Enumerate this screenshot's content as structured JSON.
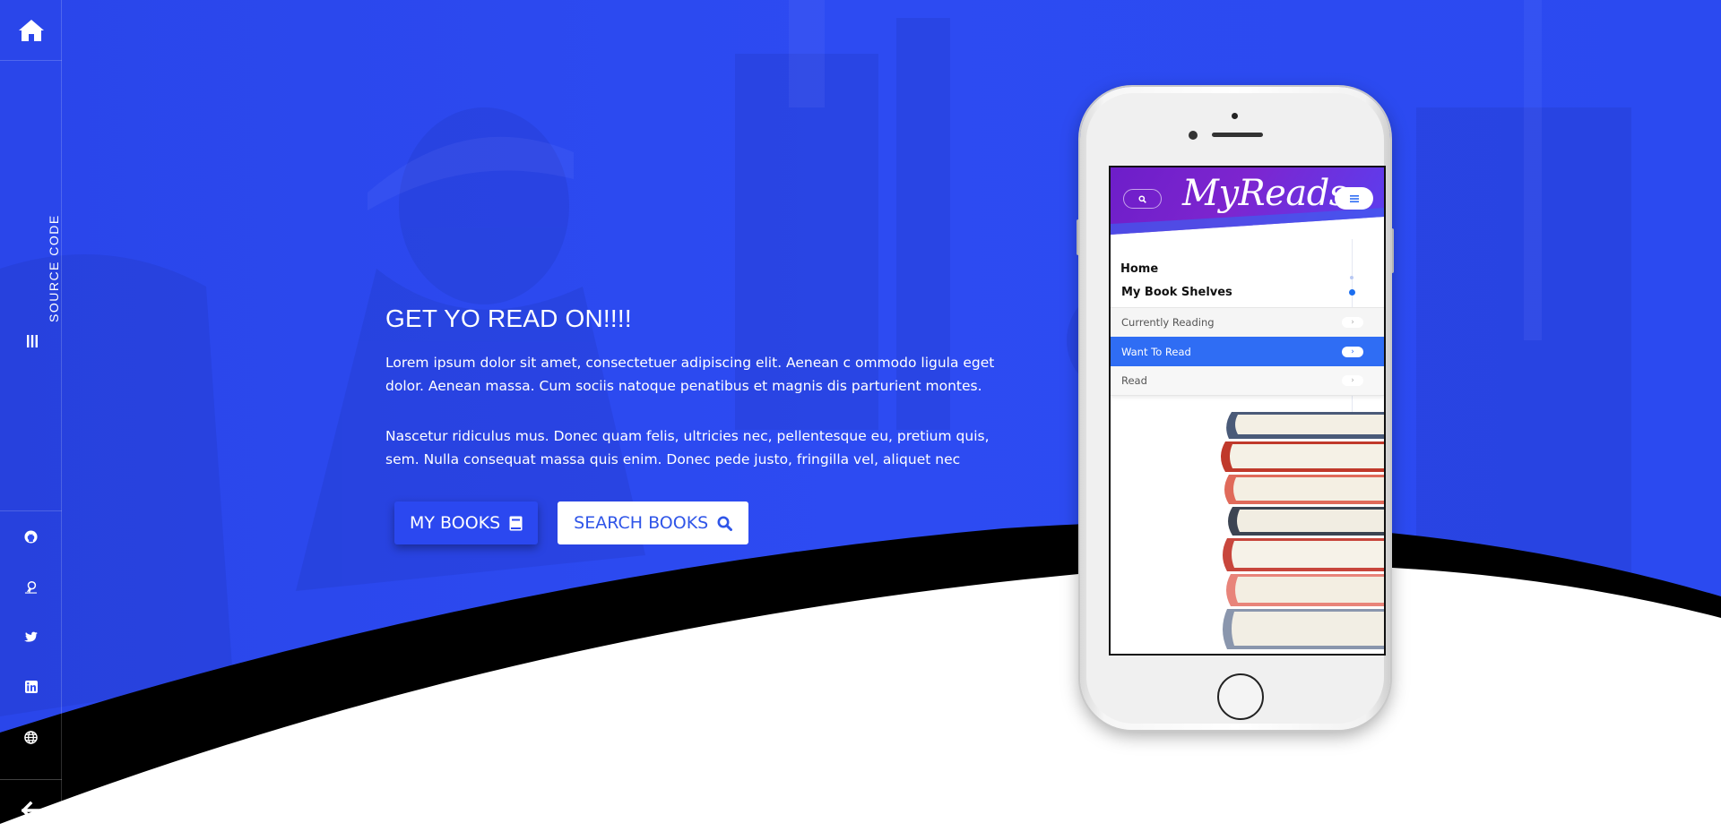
{
  "colors": {
    "hero_blue": "#2d4bf0",
    "dark_curve": "#000000",
    "accent_blue": "#2f6df4",
    "app_purple": "#6d1ec9"
  },
  "sidebar": {
    "home_icon": "home-icon",
    "source_code_label": "SOURCE CODE",
    "source_code_icon": "bars-icon",
    "social": [
      {
        "name": "github",
        "icon": "github-icon"
      },
      {
        "name": "codepen",
        "icon": "ribbon-icon"
      },
      {
        "name": "twitter",
        "icon": "twitter-icon"
      },
      {
        "name": "linkedin",
        "icon": "linkedin-icon"
      },
      {
        "name": "website",
        "icon": "globe-icon"
      }
    ],
    "back_icon": "arrow-left-icon"
  },
  "hero": {
    "title": "GET YO READ ON!!!!",
    "paragraph_1": "Lorem ipsum dolor sit amet, consectetuer adipiscing elit. Aenean c ommodo ligula eget dolor. Aenean massa. Cum sociis natoque penatibus et magnis dis parturient montes.",
    "paragraph_2": "Nascetur ridiculus mus. Donec quam felis, ultricies nec, pellentesque eu, pretium quis, sem. Nulla consequat massa quis enim. Donec pede justo, fringilla vel, aliquet nec",
    "buttons": {
      "my_books": "MY BOOKS",
      "search_books": "SEARCH BOOKS"
    }
  },
  "phone_app": {
    "logo": "MyReads",
    "nav": {
      "home": "Home",
      "shelves_title": "My Book Shelves",
      "shelves": [
        {
          "label": "Currently Reading",
          "active": false
        },
        {
          "label": "Want To Read",
          "active": true
        },
        {
          "label": "Read",
          "active": false
        }
      ]
    }
  }
}
